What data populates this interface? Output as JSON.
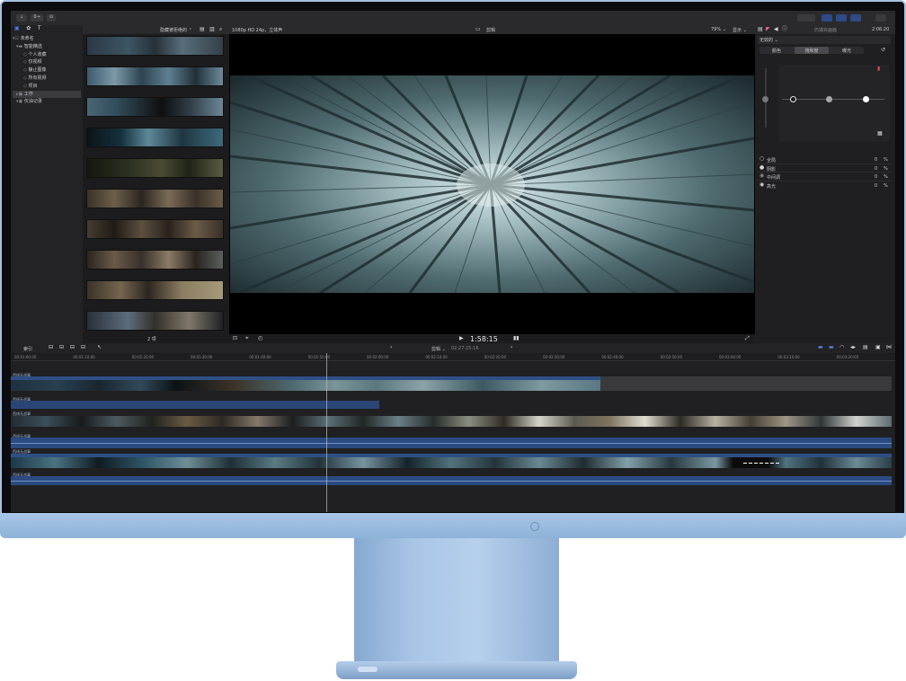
{
  "topbar": {
    "import_label": "⇣",
    "keyword_label": "0→",
    "background_label": "⊙"
  },
  "browser": {
    "sort_label": "隐藏被拒绝的 ⌃",
    "count_label": "2 项"
  },
  "sidebar": {
    "items": [
      {
        "label": "未命名",
        "icon": "disclosure-icon"
      },
      {
        "label": "智能精选",
        "icon": "folder-icon"
      },
      {
        "label": "个人收藏",
        "icon": "star-icon"
      },
      {
        "label": "仅视频",
        "icon": "gear-icon"
      },
      {
        "label": "静止图像",
        "icon": "gear-icon"
      },
      {
        "label": "所有视频",
        "icon": "gear-icon"
      },
      {
        "label": "项目",
        "icon": "gear-icon"
      },
      {
        "label": "工作",
        "icon": "event-icon"
      },
      {
        "label": "仅油记录",
        "icon": "event-icon"
      }
    ]
  },
  "viewer": {
    "format_label": "1080p HD 24p，立体声",
    "title": "剪辑",
    "zoom_label": "79% ⌄",
    "display_label": "显示 ⌄",
    "timecode": "1:58:15"
  },
  "inspector": {
    "title_right": "2:06:20",
    "subtitle": "仍填充画面",
    "board_label": "无效的 ⌄",
    "tabs": [
      "颜色",
      "饱和度",
      "曝光"
    ],
    "rows": [
      {
        "label": "全局",
        "value": "0",
        "unit": "%"
      },
      {
        "label": "阴影",
        "value": "0",
        "unit": "%"
      },
      {
        "label": "中间调",
        "value": "0",
        "unit": "%"
      },
      {
        "label": "高光",
        "value": "0",
        "unit": "%"
      }
    ]
  },
  "timeline": {
    "index_label": "索引",
    "title": "剪辑 ⌄",
    "duration": "02:27:15:16",
    "ruler": [
      "00:01:00:00",
      "00:01:10:00",
      "00:01:20:00",
      "00:01:30:00",
      "00:01:40:00",
      "00:01:50:00",
      "00:02:00:00",
      "00:02:10:00",
      "00:02:20:00",
      "00:02:30:00",
      "00:02:40:00",
      "00:02:50:00",
      "00:03:00:00",
      "00:03:10:00",
      "00:03:20:00"
    ],
    "clip_label": "西线无战事",
    "clip_labels": [
      "西线无战事",
      "西线无战事",
      "西线无战事",
      "西线无战事",
      "西线无战事",
      "西线无战事"
    ]
  }
}
